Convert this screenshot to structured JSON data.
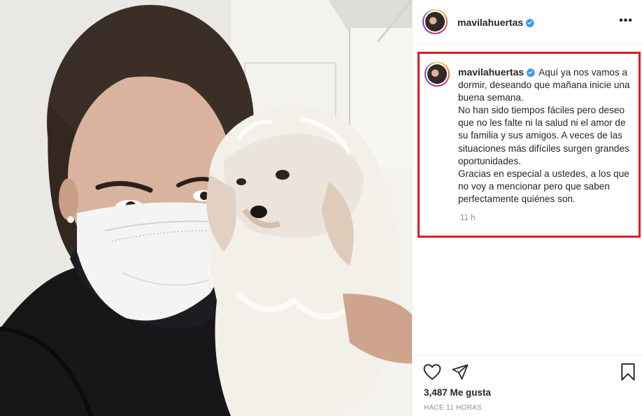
{
  "post": {
    "username": "mavilahuertas",
    "verified_icon": "verified-badge-icon",
    "more_icon": "more-options-icon",
    "more_label": "•••"
  },
  "caption": {
    "username": "mavilahuertas",
    "lines": [
      "Aquí ya nos vamos a dormir, deseando que mañana inicie una buena semana.",
      "No han sido tiempos fáciles pero deseo que no les falte ni la salud ni el amor de su familia y sus amigos. A veces de las situaciones más difíciles surgen grandes oportunidades.",
      "Gracias en especial a ustedes, a los que no voy a mencionar pero que saben perfectamente quiénes son."
    ],
    "time": "11 h",
    "highlight_color": "#d51f28"
  },
  "actions": {
    "like_icon": "heart-icon",
    "share_icon": "paper-plane-icon",
    "save_icon": "bookmark-icon",
    "likes": "3,487 Me gusta",
    "posted_ago": "HACE 11 HORAS"
  },
  "colors": {
    "verified": "#3897f0",
    "text": "#262626",
    "muted": "#8e8e8e"
  }
}
